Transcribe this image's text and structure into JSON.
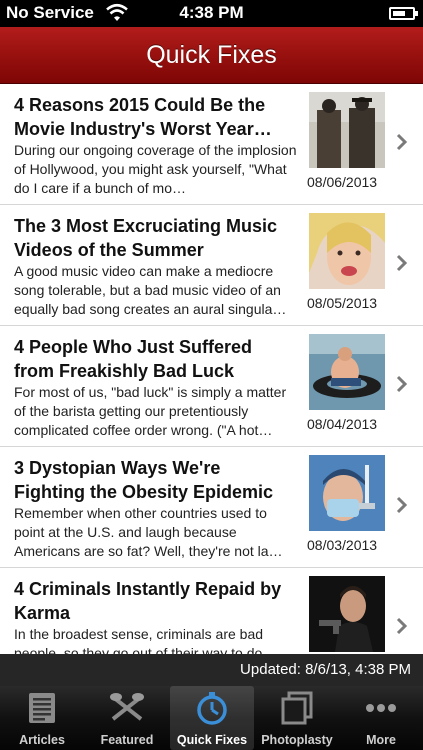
{
  "status": {
    "carrier": "No Service",
    "time": "4:38 PM"
  },
  "nav": {
    "title": "Quick Fixes"
  },
  "articles": [
    {
      "title": "4 Reasons 2015 Could Be the Movie Industry's Worst Year…",
      "blurb": "During our ongoing coverage of the implosion of Hollywood, you might ask yourself, \"What do I care if a bunch of mo…",
      "date": "08/06/2013"
    },
    {
      "title": "The 3 Most Excruciating Music Videos of the Summer",
      "blurb": "A good music video can make a mediocre song tolerable, but a bad music video of an equally bad song creates an aural singula…",
      "date": "08/05/2013"
    },
    {
      "title": "4 People Who Just Suffered from Freakishly Bad Luck",
      "blurb": "For most of us, \"bad luck\" is simply a matter of the barista getting our pretentiously complicated coffee order wrong. (\"A hot…",
      "date": "08/04/2013"
    },
    {
      "title": "3 Dystopian Ways We're Fighting the Obesity Epidemic",
      "blurb": "Remember when other countries used to point at the U.S. and laugh because Americans are so fat? Well, they're not la…",
      "date": "08/03/2013"
    },
    {
      "title": "4 Criminals Instantly Repaid by Karma",
      "blurb": "In the broadest sense, criminals are bad people, so they go out of their way to do…",
      "date": ""
    }
  ],
  "update_banner": {
    "text": "Updated: 8/6/13, 4:38 PM"
  },
  "tabs": [
    {
      "label": "Articles",
      "icon": "articles-icon"
    },
    {
      "label": "Featured",
      "icon": "featured-icon"
    },
    {
      "label": "Quick Fixes",
      "icon": "stopwatch-icon",
      "active": true
    },
    {
      "label": "Photoplasty",
      "icon": "photoplasty-icon"
    },
    {
      "label": "More",
      "icon": "more-icon"
    }
  ],
  "colors": {
    "nav_red": "#9a1210",
    "tab_active_icon": "#3a8fd8"
  }
}
